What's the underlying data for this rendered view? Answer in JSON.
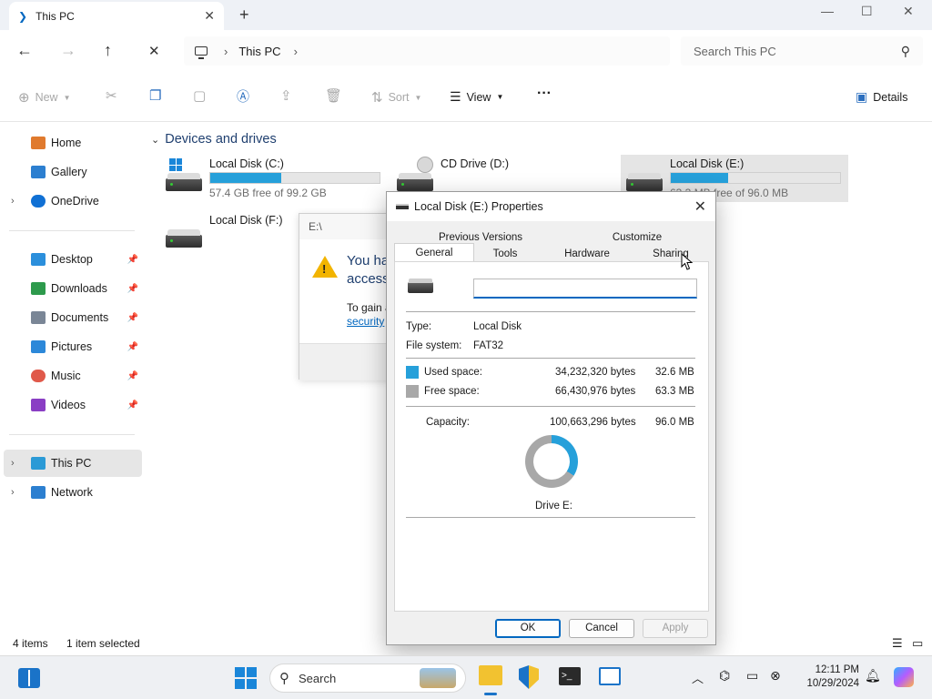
{
  "tab": {
    "title": "This PC",
    "close": "✕",
    "new": "+"
  },
  "window_controls": {
    "minimize": "—",
    "maximize": "☐",
    "close": "✕"
  },
  "nav_buttons": {
    "back": "←",
    "forward": "→",
    "up": "↑",
    "stop": "✕"
  },
  "address": {
    "crumb": "This PC",
    "sep": "›"
  },
  "search": {
    "placeholder": "Search This PC"
  },
  "commands": {
    "new": "New",
    "sort": "Sort",
    "view": "View",
    "more": "···",
    "details": "Details"
  },
  "sidebar": {
    "items": [
      {
        "label": "Home",
        "color": "#e07a2e"
      },
      {
        "label": "Gallery",
        "color": "#2c7fd0"
      },
      {
        "label": "OneDrive",
        "color": "#1070d4"
      },
      {
        "label": "Desktop",
        "color": "#2b8fdc"
      },
      {
        "label": "Downloads",
        "color": "#2d9a4c"
      },
      {
        "label": "Documents",
        "color": "#7a8696"
      },
      {
        "label": "Pictures",
        "color": "#2c88d9"
      },
      {
        "label": "Music",
        "color": "#e0594a"
      },
      {
        "label": "Videos",
        "color": "#8a3ec4"
      },
      {
        "label": "This PC",
        "color": "#2b9ad6"
      },
      {
        "label": "Network",
        "color": "#2c7fd0"
      }
    ]
  },
  "group": {
    "title": "Devices and drives"
  },
  "drives": [
    {
      "name": "Local Disk (C:)",
      "free": "57.4 GB free of 99.2 GB",
      "used_fraction": 0.42
    },
    {
      "name": "CD Drive (D:)"
    },
    {
      "name": "Local Disk (E:)",
      "free": "63.3 MB free of 96.0 MB",
      "used_fraction": 0.34
    },
    {
      "name": "Local Disk (F:)"
    }
  ],
  "error_dialog": {
    "title": "E:\\",
    "message": "You ha\naccess",
    "text": "To gain a",
    "link": "security"
  },
  "properties": {
    "title": "Local Disk (E:) Properties",
    "tabs_row1": [
      "Previous Versions",
      "Customize"
    ],
    "tabs_row2": [
      "General",
      "Tools",
      "Hardware",
      "Sharing"
    ],
    "name_value": "",
    "type_label": "Type:",
    "type_value": "Local Disk",
    "fs_label": "File system:",
    "fs_value": "FAT32",
    "used_label": "Used space:",
    "used_bytes": "34,232,320 bytes",
    "used_human": "32.6 MB",
    "free_label": "Free space:",
    "free_bytes": "66,430,976 bytes",
    "free_human": "63.3 MB",
    "cap_label": "Capacity:",
    "cap_bytes": "100,663,296 bytes",
    "cap_human": "96.0 MB",
    "drive_caption": "Drive E:",
    "used_fraction": 0.34,
    "used_color": "#26a0da",
    "free_color": "#a8a8a8",
    "ok": "OK",
    "cancel": "Cancel",
    "apply": "Apply"
  },
  "status": {
    "items": "4 items",
    "selected": "1 item selected"
  },
  "taskbar": {
    "search": "Search",
    "time": "12:11 PM",
    "date": "10/29/2024"
  }
}
